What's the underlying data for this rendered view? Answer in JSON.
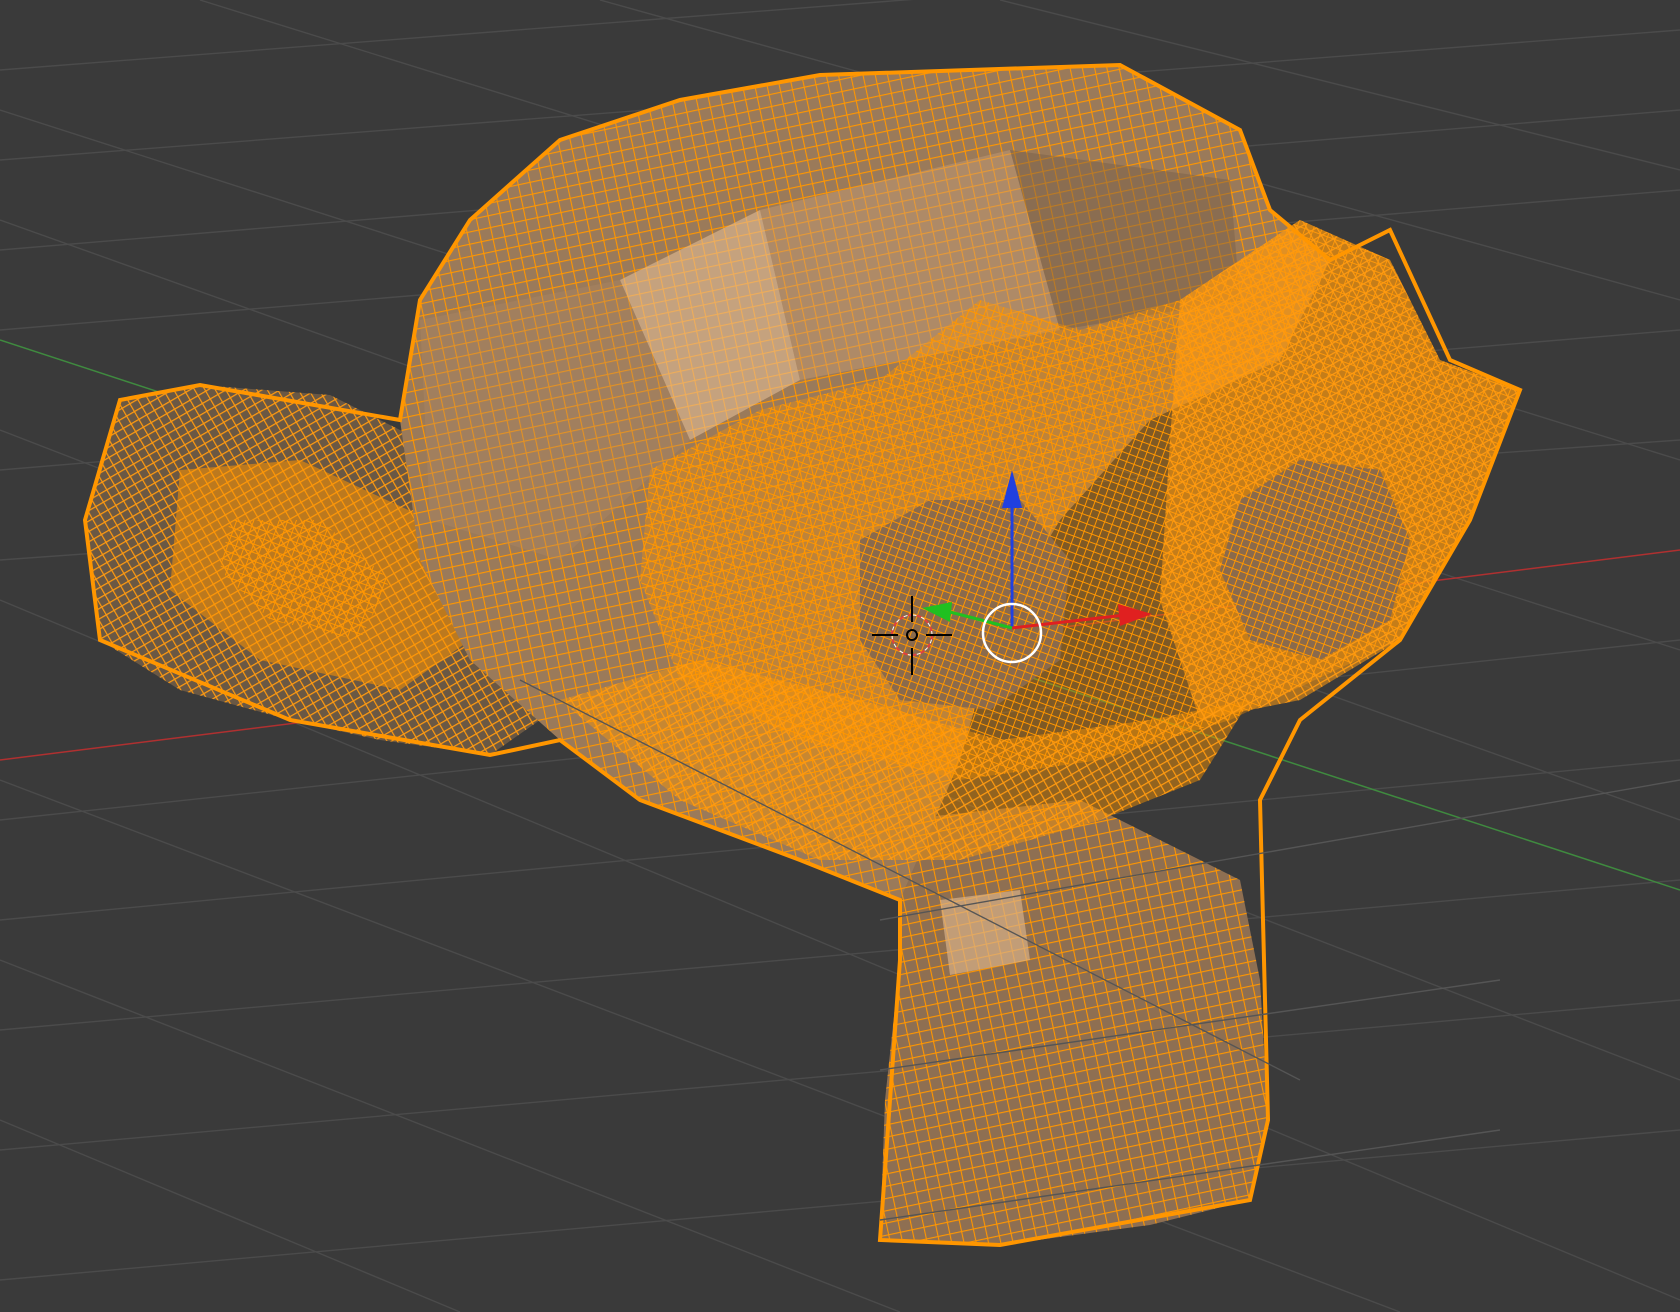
{
  "viewport": {
    "mode": "edit-mode",
    "shading": "solid",
    "mesh": "suzanne-subdivided",
    "selection": "all-vertices-selected"
  },
  "colors": {
    "background": "#3a3a3a",
    "grid_line": "#4d4d4d",
    "x_axis": "#b03030",
    "y_axis": "#3f8a3f",
    "mesh_wire": "#ff9600",
    "mesh_face_light": "#d9b088",
    "mesh_face_mid": "#a98462",
    "mesh_face_dark": "#6e5a45",
    "gizmo_x": "#e02020",
    "gizmo_y": "#20c020",
    "gizmo_z": "#2040e0",
    "gizmo_ring": "#ffffff",
    "cursor": "#000000",
    "cursor_ring": "#e04040"
  },
  "gizmo": {
    "tool": "translate",
    "axes": [
      "x-axis-arrow",
      "y-axis-arrow",
      "z-axis-arrow"
    ],
    "center": "white-circle"
  },
  "cursor_3d": {
    "icon": "crosshair-icon"
  }
}
